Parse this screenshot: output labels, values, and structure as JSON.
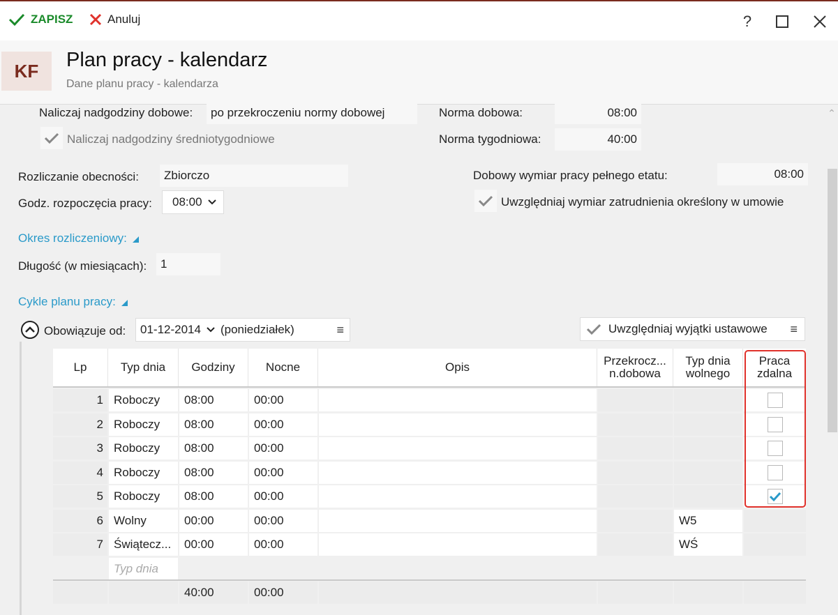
{
  "toolbar": {
    "save_label": "ZAPISZ",
    "cancel_label": "Anuluj",
    "help": "?"
  },
  "header": {
    "avatar": "KF",
    "title": "Plan pracy - kalendarz",
    "subtitle": "Dane planu pracy - kalendarza"
  },
  "form": {
    "overtime_daily_label": "Naliczaj nadgodziny dobowe:",
    "overtime_daily_value": "po przekroczeniu normy dobowej",
    "overtime_weekly_label": "Naliczaj nadgodziny średniotygodniowe",
    "norm_daily_label": "Norma dobowa:",
    "norm_daily_value": "08:00",
    "norm_weekly_label": "Norma tygodniowa:",
    "norm_weekly_value": "40:00",
    "attendance_label": "Rozliczanie obecności:",
    "attendance_value": "Zbiorczo",
    "start_hour_label": "Godz. rozpoczęcia pracy:",
    "start_hour_value": "08:00",
    "fulltime_label": "Dobowy wymiar pracy pełnego etatu:",
    "fulltime_value": "08:00",
    "contract_label": "Uwzględniaj wymiar zatrudnienia określony w umowie",
    "period_link": "Okres rozliczeniowy:",
    "length_label": "Długość (w miesiącach):",
    "length_value": "1",
    "cycles_link": "Cykle planu pracy:",
    "valid_from_label": "Obowiązuje od:",
    "valid_from_date": "01-12-2014",
    "valid_from_day": "(poniedziałek)",
    "exceptions_label": "Uwzględniaj wyjątki ustawowe"
  },
  "grid": {
    "headers": {
      "lp": "Lp",
      "type": "Typ dnia",
      "hours": "Godziny",
      "night": "Nocne",
      "desc": "Opis",
      "over_1": "Przekrocz...",
      "over_2": "n.dobowa",
      "free_1": "Typ dnia",
      "free_2": "wolnego",
      "remote_1": "Praca",
      "remote_2": "zdalna"
    },
    "rows": [
      {
        "lp": "1",
        "type": "Roboczy",
        "hours": "08:00",
        "night": "00:00",
        "free": "",
        "remote": "unchecked"
      },
      {
        "lp": "2",
        "type": "Roboczy",
        "hours": "08:00",
        "night": "00:00",
        "free": "",
        "remote": "unchecked"
      },
      {
        "lp": "3",
        "type": "Roboczy",
        "hours": "08:00",
        "night": "00:00",
        "free": "",
        "remote": "unchecked"
      },
      {
        "lp": "4",
        "type": "Roboczy",
        "hours": "08:00",
        "night": "00:00",
        "free": "",
        "remote": "unchecked"
      },
      {
        "lp": "5",
        "type": "Roboczy",
        "hours": "08:00",
        "night": "00:00",
        "free": "",
        "remote": "checked"
      },
      {
        "lp": "6",
        "type": "Wolny",
        "hours": "00:00",
        "night": "00:00",
        "free": "W5",
        "remote": ""
      },
      {
        "lp": "7",
        "type": "Świątecz...",
        "hours": "00:00",
        "night": "00:00",
        "free": "WŚ",
        "remote": ""
      }
    ],
    "new_row_placeholder": "Typ dnia",
    "totals": {
      "hours": "40:00",
      "night": "00:00"
    }
  },
  "colors": {
    "accent": "#2a9ac9",
    "save": "#1a8a2a",
    "cancel": "#e0312b",
    "brand": "#7a2b1e",
    "highlight": "#e0312b"
  }
}
